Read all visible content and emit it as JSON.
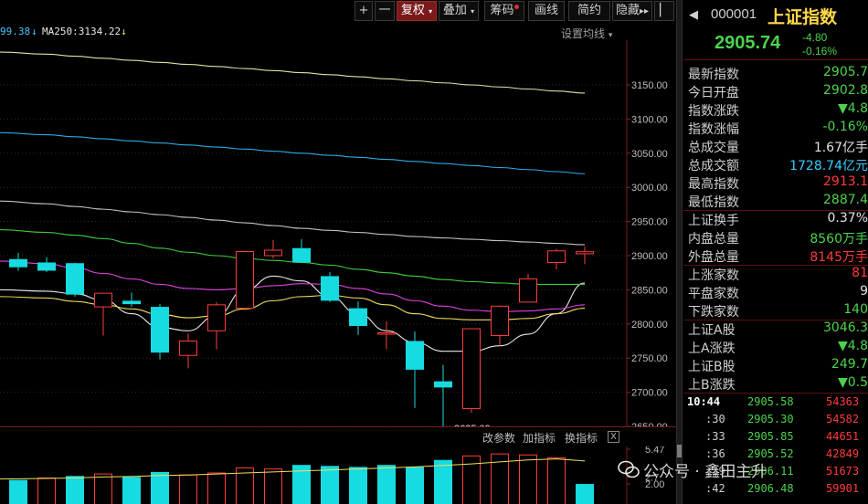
{
  "toolbar": {
    "plus": "+",
    "minus": "一",
    "fuquan": "复权",
    "diejia": "叠加",
    "chouma": "筹码",
    "huaxian": "画线",
    "jianyue": "简约",
    "yincang": "隐藏",
    "more": "▸▸",
    "side": "▏"
  },
  "ma_line": {
    "item1": "99.38",
    "item1_color": "#4fc3ff",
    "arrow1": "↓",
    "item2": "MA250:3134.22",
    "item2_color": "#e8e8e8",
    "arrow2": "↓",
    "arrow2_color": "#ffd84a"
  },
  "setting_ma": "设置均线",
  "price_axis": [
    "3150.00",
    "3100.00",
    "3050.00",
    "3000.00",
    "2950.00",
    "2900.00",
    "2850.00",
    "2800.00",
    "2750.00",
    "2700.00",
    "2650.00"
  ],
  "low_annotation": "2635.09",
  "volume_axis": [
    "5.47",
    "2.7",
    "2.00"
  ],
  "sub_header": {
    "modify_params": "改参数",
    "add_indicator": "加指标",
    "switch_indicator": "换指标",
    "close": "X"
  },
  "colors": {
    "up": "#ff3b3b",
    "down": "#16dbe0",
    "ma_white": "#e8e8e8",
    "ma_yellow": "#f0e060",
    "ma_magenta": "#e040e0",
    "ma_green": "#3cc83c",
    "ma_cyan": "#2ea8e8",
    "ma_light": "#e0e0a8"
  },
  "chart_data": {
    "type": "candlestick",
    "ohlc": [
      {
        "o": 2895,
        "h": 2904,
        "l": 2878,
        "c": 2883
      },
      {
        "o": 2890,
        "h": 2898,
        "l": 2876,
        "c": 2878
      },
      {
        "o": 2889,
        "h": 2890,
        "l": 2840,
        "c": 2843
      },
      {
        "o": 2825,
        "h": 2845,
        "l": 2783,
        "c": 2845
      },
      {
        "o": 2834,
        "h": 2846,
        "l": 2825,
        "c": 2829
      },
      {
        "o": 2825,
        "h": 2829,
        "l": 2748,
        "c": 2758
      },
      {
        "o": 2754,
        "h": 2786,
        "l": 2735,
        "c": 2775
      },
      {
        "o": 2790,
        "h": 2832,
        "l": 2763,
        "c": 2828
      },
      {
        "o": 2823,
        "h": 2905,
        "l": 2820,
        "c": 2906
      },
      {
        "o": 2900,
        "h": 2923,
        "l": 2896,
        "c": 2908
      },
      {
        "o": 2911,
        "h": 2924,
        "l": 2890,
        "c": 2890
      },
      {
        "o": 2870,
        "h": 2876,
        "l": 2832,
        "c": 2834
      },
      {
        "o": 2823,
        "h": 2833,
        "l": 2784,
        "c": 2797
      },
      {
        "o": 2787,
        "h": 2804,
        "l": 2763,
        "c": 2787
      },
      {
        "o": 2775,
        "h": 2789,
        "l": 2677,
        "c": 2733
      },
      {
        "o": 2716,
        "h": 2740,
        "l": 2635.09,
        "c": 2707
      },
      {
        "o": 2676,
        "h": 2793,
        "l": 2670,
        "c": 2793
      },
      {
        "o": 2783,
        "h": 2827,
        "l": 2768,
        "c": 2826
      },
      {
        "o": 2832,
        "h": 2873,
        "l": 2832,
        "c": 2866
      },
      {
        "o": 2890,
        "h": 2910,
        "l": 2880,
        "c": 2907
      },
      {
        "o": 2902.8,
        "h": 2913.1,
        "l": 2887.4,
        "c": 2905.74
      }
    ],
    "ma_series": [
      {
        "color": "#e8e8e8",
        "values": [
          2850,
          2848,
          2844,
          2835,
          2815,
          2795,
          2790,
          2812,
          2850,
          2870,
          2863,
          2840,
          2815,
          2790,
          2773,
          2760,
          2760,
          2768,
          2785,
          2815,
          2860
        ]
      },
      {
        "color": "#f0e060",
        "values": [
          2840,
          2838,
          2833,
          2828,
          2822,
          2814,
          2809,
          2812,
          2822,
          2834,
          2840,
          2842,
          2838,
          2828,
          2815,
          2808,
          2806,
          2806,
          2808,
          2815,
          2823
        ]
      },
      {
        "color": "#e040e0",
        "values": [
          2892,
          2888,
          2882,
          2874,
          2866,
          2858,
          2852,
          2850,
          2852,
          2856,
          2859,
          2858,
          2852,
          2844,
          2834,
          2826,
          2820,
          2818,
          2819,
          2822,
          2828
        ]
      },
      {
        "color": "#3cc83c",
        "values": [
          2938,
          2934,
          2930,
          2925,
          2918,
          2911,
          2905,
          2900,
          2896,
          2893,
          2890,
          2886,
          2880,
          2875,
          2870,
          2865,
          2862,
          2860,
          2858,
          2858,
          2858
        ]
      },
      {
        "color": "#c0c0c0",
        "values": [
          2980,
          2976,
          2972,
          2968,
          2964,
          2960,
          2956,
          2952,
          2948,
          2944,
          2940,
          2937,
          2934,
          2931,
          2928,
          2926,
          2924,
          2922,
          2920,
          2918,
          2916
        ]
      },
      {
        "color": "#2ea8e8",
        "values": [
          3080,
          3077,
          3074,
          3071,
          3068,
          3065,
          3062,
          3059,
          3056,
          3053,
          3050,
          3047,
          3044,
          3041,
          3038,
          3035,
          3032,
          3029,
          3026,
          3023,
          3020
        ]
      },
      {
        "color": "#e0e0a8",
        "values": [
          3198,
          3195,
          3192,
          3189,
          3186,
          3183,
          3180,
          3177,
          3174,
          3171,
          3168,
          3165,
          3162,
          3159,
          3156,
          3153,
          3150,
          3147,
          3144,
          3141,
          3138
        ]
      }
    ],
    "volume": [
      {
        "v": 2.4,
        "up": false
      },
      {
        "v": 2.6,
        "up": true
      },
      {
        "v": 2.8,
        "up": false
      },
      {
        "v": 3.0,
        "up": true
      },
      {
        "v": 2.7,
        "up": false
      },
      {
        "v": 3.2,
        "up": false
      },
      {
        "v": 2.9,
        "up": true
      },
      {
        "v": 3.1,
        "up": true
      },
      {
        "v": 3.6,
        "up": true
      },
      {
        "v": 3.5,
        "up": true
      },
      {
        "v": 3.9,
        "up": false
      },
      {
        "v": 3.8,
        "up": false
      },
      {
        "v": 3.7,
        "up": false
      },
      {
        "v": 3.9,
        "up": false
      },
      {
        "v": 3.7,
        "up": false
      },
      {
        "v": 4.4,
        "up": false
      },
      {
        "v": 4.8,
        "up": true
      },
      {
        "v": 5.0,
        "up": true
      },
      {
        "v": 4.9,
        "up": true
      },
      {
        "v": 4.6,
        "up": true
      },
      {
        "v": 2.0,
        "up": false
      }
    ],
    "volume_ma": [
      2.5,
      2.55,
      2.6,
      2.7,
      2.75,
      2.85,
      2.9,
      3.0,
      3.1,
      3.2,
      3.3,
      3.4,
      3.5,
      3.6,
      3.7,
      3.85,
      4.0,
      4.2,
      4.4,
      4.5,
      4.3
    ],
    "ylim": [
      2620,
      3190
    ],
    "vol_lim": [
      0,
      5.47
    ]
  },
  "panel": {
    "back": "◀",
    "code": "000001",
    "name": "上证指数",
    "price": "2905.74",
    "change": "-4.80",
    "change_pct": "-0.16%",
    "rows1": [
      {
        "label": "最新指数",
        "value": "2905.7",
        "color": "#4cd34c"
      },
      {
        "label": "今日开盘",
        "value": "2902.8",
        "color": "#4cd34c"
      },
      {
        "label": "指数涨跌",
        "value": "▼4.8",
        "color": "#4cd34c"
      },
      {
        "label": "指数涨幅",
        "value": "-0.16%",
        "color": "#4cd34c"
      },
      {
        "label": "总成交量",
        "value": "1.67亿手",
        "color": "#e0e0e0"
      },
      {
        "label": "总成交额",
        "value": "1728.74亿元",
        "color": "#33ccff"
      },
      {
        "label": "最高指数",
        "value": "2913.1",
        "color": "#ff3b3b"
      },
      {
        "label": "最低指数",
        "value": "2887.4",
        "color": "#4cd34c"
      }
    ],
    "rows2": [
      {
        "label": "上证换手",
        "value": "0.37%",
        "color": "#e0e0e0"
      },
      {
        "label": "内盘总量",
        "value": "8560万手",
        "color": "#4cd34c"
      },
      {
        "label": "外盘总量",
        "value": "8145万手",
        "color": "#ff3b3b"
      }
    ],
    "rows3": [
      {
        "label": "上涨家数",
        "value": "81",
        "color": "#ff3b3b"
      },
      {
        "label": "平盘家数",
        "value": "9",
        "color": "#e0e0e0"
      },
      {
        "label": "下跌家数",
        "value": "140",
        "color": "#4cd34c"
      }
    ],
    "rows4": [
      {
        "label": "上证A股",
        "value": "3046.3",
        "color": "#4cd34c"
      },
      {
        "label": "上A涨跌",
        "value": "▼4.8",
        "color": "#4cd34c"
      },
      {
        "label": "上证B股",
        "value": "249.7",
        "color": "#4cd34c"
      },
      {
        "label": "上B涨跌",
        "value": "▼0.5",
        "color": "#4cd34c"
      }
    ],
    "ticks": [
      {
        "time": "10:44",
        "price": "2905.58",
        "vol": "54363"
      },
      {
        "time": ":30",
        "price": "2905.30",
        "vol": "54582"
      },
      {
        "time": ":33",
        "price": "2905.85",
        "vol": "44651"
      },
      {
        "time": ":36",
        "price": "2905.52",
        "vol": "42849"
      },
      {
        "time": ":39",
        "price": "2906.11",
        "vol": "51673"
      },
      {
        "time": ":42",
        "price": "2906.48",
        "vol": "59901"
      }
    ]
  },
  "watermark": "公众号 · 鑫田主升"
}
